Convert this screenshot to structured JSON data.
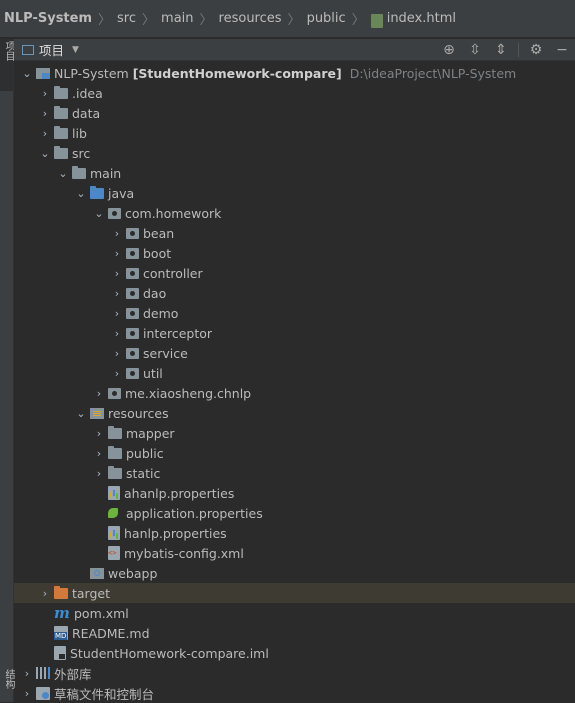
{
  "breadcrumb": [
    "NLP-System",
    "src",
    "main",
    "resources",
    "public",
    "index.html"
  ],
  "tool_stripe": {
    "top_label": "项目",
    "bottom_label": "结构"
  },
  "panel": {
    "title": "项目",
    "actions": [
      "locate-icon",
      "expand-all-icon",
      "collapse-all-icon",
      "gear-icon",
      "hide-icon"
    ]
  },
  "tree": {
    "root": {
      "name": "NLP-System",
      "module": "[StudentHomework-compare]",
      "path": "D:\\ideaProject\\NLP-System"
    },
    "idea": ".idea",
    "data": "data",
    "lib": "lib",
    "src": "src",
    "main": "main",
    "java": "java",
    "com_homework": "com.homework",
    "bean": "bean",
    "boot": "boot",
    "controller": "controller",
    "dao": "dao",
    "demo": "demo",
    "interceptor": "interceptor",
    "service": "service",
    "util": "util",
    "me_xiaosheng": "me.xiaosheng.chnlp",
    "resources": "resources",
    "mapper": "mapper",
    "public": "public",
    "static": "static",
    "ahanlp": "ahanlp.properties",
    "application": "application.properties",
    "hanlp": "hanlp.properties",
    "mybatis": "mybatis-config.xml",
    "webapp": "webapp",
    "target": "target",
    "pom": "pom.xml",
    "readme": "README.md",
    "iml": "StudentHomework-compare.iml",
    "external_libs": "外部库",
    "scratches": "草稿文件和控制台"
  }
}
